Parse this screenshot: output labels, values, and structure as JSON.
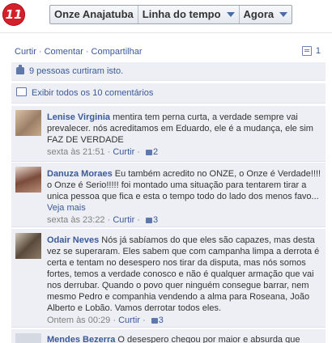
{
  "header": {
    "logo_text": "11",
    "page_name": "Onze Anajatuba",
    "timeline_label": "Linha do tempo",
    "now_label": "Agora"
  },
  "actions": {
    "like": "Curtir",
    "comment": "Comentar",
    "share": "Compartilhar",
    "comment_count": "1"
  },
  "likes_text": "9 pessoas curtiram isto.",
  "view_all_text": "Exibir todos os 10 comentários",
  "comments": [
    {
      "author": "Lenise Virginia",
      "text": " mentira tem perna curta, a verdade sempre vai prevalecer. nós acreditamos em Eduardo, ele é a mudança, ele sim FAZ DE VERDADE",
      "time": "sexta às 21:51",
      "like": "Curtir",
      "likes": "2"
    },
    {
      "author": "Danuza Moraes",
      "text": " Eu também acredito no ONZE, o Onze é Verdade!!!! o Onze é Serio!!!!! foi montado uma situação para tentarem tirar a unica pessoa que fica e esta o tempo todo do lado dos menos favo...",
      "see_more": "Veja mais",
      "time": "sexta às 23:22",
      "like": "Curtir",
      "likes": "3"
    },
    {
      "author": "Odair Neves",
      "text": " Nós já sabíamos do que eles são capazes, mas desta vez se superaram. Eles sabem que com campanha limpa a derrota é certa e tentam no desespero nos tirar da disputa, mas nós somos fortes, temos a verdade conosco e não é qualquer armação que vai nos derrubar. Quando o povo quer ninguém consegue barrar, nem mesmo Pedro e companhia vendendo a alma para Roseana, João Alberto e Lobão. Vamos derrotar todos eles.",
      "time": "Ontem às 00:29",
      "like": "Curtir",
      "likes": "3"
    },
    {
      "author": "Mendes Bezerra",
      "text": " O desespero chegou por maior e absurda que"
    }
  ],
  "colors": {
    "accent": "#3b5998",
    "feedback_bg": "#edeff4",
    "logo_red": "#d4202a"
  }
}
